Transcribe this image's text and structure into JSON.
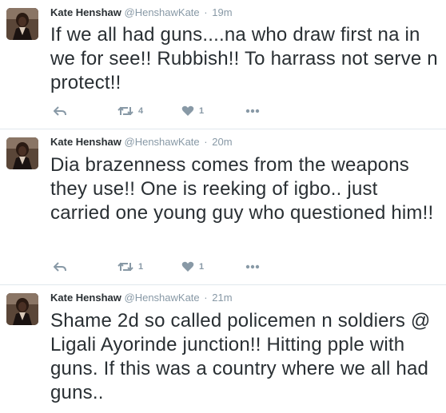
{
  "tweets": [
    {
      "name": "Kate Henshaw",
      "handle": "@HenshawKate",
      "separator": "·",
      "time": "19m",
      "text": "If we all had guns....na who draw first na in we for see!! Rubbish!! To harrass not serve n protect!!",
      "retweets": "4",
      "likes": "1"
    },
    {
      "name": "Kate Henshaw",
      "handle": "@HenshawKate",
      "separator": "·",
      "time": "20m",
      "text": "Dia brazenness comes from the weapons they use!! One is reeking of igbo.. just carried one young guy who questioned him!!",
      "retweets": "1",
      "likes": "1"
    },
    {
      "name": "Kate Henshaw",
      "handle": "@HenshawKate",
      "separator": "·",
      "time": "21m",
      "text": "Shame 2d so called policemen n soldiers @ Ligali Ayorinde junction!! Hitting pple with guns. If this was a country where we all had guns..",
      "retweets": "",
      "likes": ""
    }
  ],
  "icons": {
    "reply": "reply-icon",
    "retweet": "retweet-icon",
    "like": "heart-icon",
    "more": "more-icon"
  },
  "colors": {
    "text": "#292f33",
    "secondary": "#8899a6",
    "border": "#e1e8ed"
  }
}
